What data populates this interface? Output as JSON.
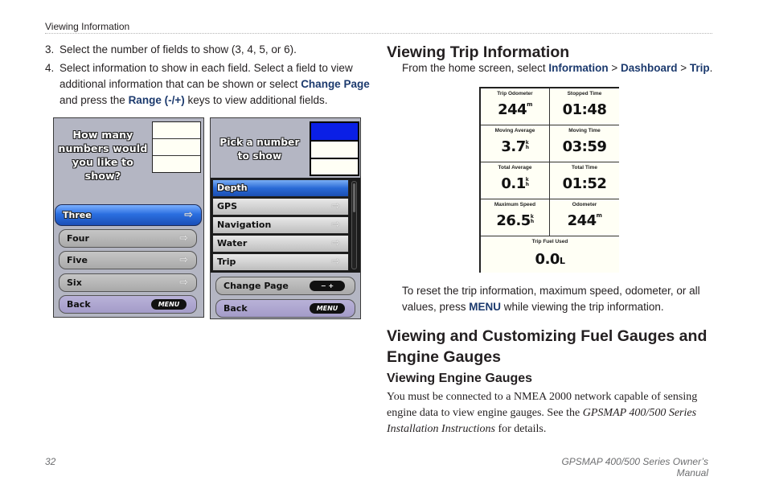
{
  "header": {
    "running_head": "Viewing Information"
  },
  "left": {
    "steps": [
      {
        "num": "3.",
        "lines": [
          "Select the number of fields to show (3, 4, 5, or 6)."
        ]
      },
      {
        "num": "4.",
        "line1": "Select information to show in each field. Select a field to view",
        "line2_pre": "additional information that can be shown or select ",
        "line2_kw": "Change Page",
        "line3_pre": "and press the ",
        "line3_kw": "Range (-/+)",
        "line3_post": " keys to view additional fields."
      }
    ],
    "screen1": {
      "prompt": [
        "How many",
        "numbers would",
        "you like to",
        "show?"
      ],
      "options": [
        {
          "label": "Three",
          "selected": true
        },
        {
          "label": "Four",
          "selected": false
        },
        {
          "label": "Five",
          "selected": false
        },
        {
          "label": "Six",
          "selected": false
        }
      ],
      "back_label": "Back",
      "menu_key": "MENU",
      "arrow_icon": "⇨"
    },
    "screen2": {
      "prompt": [
        "Pick a number",
        "to show"
      ],
      "items": [
        {
          "label": "Depth",
          "selected": true
        },
        {
          "label": "GPS",
          "selected": false
        },
        {
          "label": "Navigation",
          "selected": false
        },
        {
          "label": "Water",
          "selected": false
        },
        {
          "label": "Trip",
          "selected": false
        }
      ],
      "change_page_label": "Change Page",
      "range_key": "−  +",
      "back_label": "Back",
      "menu_key": "MENU",
      "arrow_icon": "⇨"
    }
  },
  "right": {
    "trip": {
      "heading": "Viewing Trip Information",
      "intro_pre": "From the home screen, select ",
      "path": [
        "Information",
        "Dashboard",
        "Trip"
      ],
      "sep": " > ",
      "end": ".",
      "dashboard": [
        {
          "label": "Trip Odometer",
          "value": "244",
          "unit": "m"
        },
        {
          "label": "Stopped Time",
          "value": "01:48",
          "unit": ""
        },
        {
          "label": "Moving Average",
          "value": "3.7",
          "unit_top": "k",
          "unit_bot": "h"
        },
        {
          "label": "Moving Time",
          "value": "03:59",
          "unit": ""
        },
        {
          "label": "Total Average",
          "value": "0.1",
          "unit_top": "k",
          "unit_bot": "h"
        },
        {
          "label": "Total Time",
          "value": "01:52",
          "unit": ""
        },
        {
          "label": "Maximum Speed",
          "value": "26.5",
          "unit_top": "k",
          "unit_bot": "h"
        },
        {
          "label": "Odometer",
          "value": "244",
          "unit": "m"
        },
        {
          "label": "Trip Fuel Used",
          "value": "0.0",
          "unit_l": "L"
        }
      ],
      "reset_line1": "To reset the trip information, maximum speed, odometer, or all",
      "reset_pre": "values, press ",
      "reset_kw": "MENU",
      "reset_post": " while viewing the trip information."
    },
    "gauges": {
      "heading_line1": "Viewing and Customizing Fuel Gauges and",
      "heading_line2": "Engine Gauges",
      "subheading": "Viewing Engine Gauges",
      "body_line1": "You must be connected to a NMEA 2000 network capable of sensing",
      "body_line2_pre": "engine data to view engine gauges. See the ",
      "body_line2_it": "GPSMAP 400/500 Series",
      "body_line3_it": "Installation Instructions",
      "body_line3_post": " for details."
    }
  },
  "footer": {
    "page_number": "32",
    "manual_title": "GPSMAP 400/500 Series Owner’s Manual"
  }
}
